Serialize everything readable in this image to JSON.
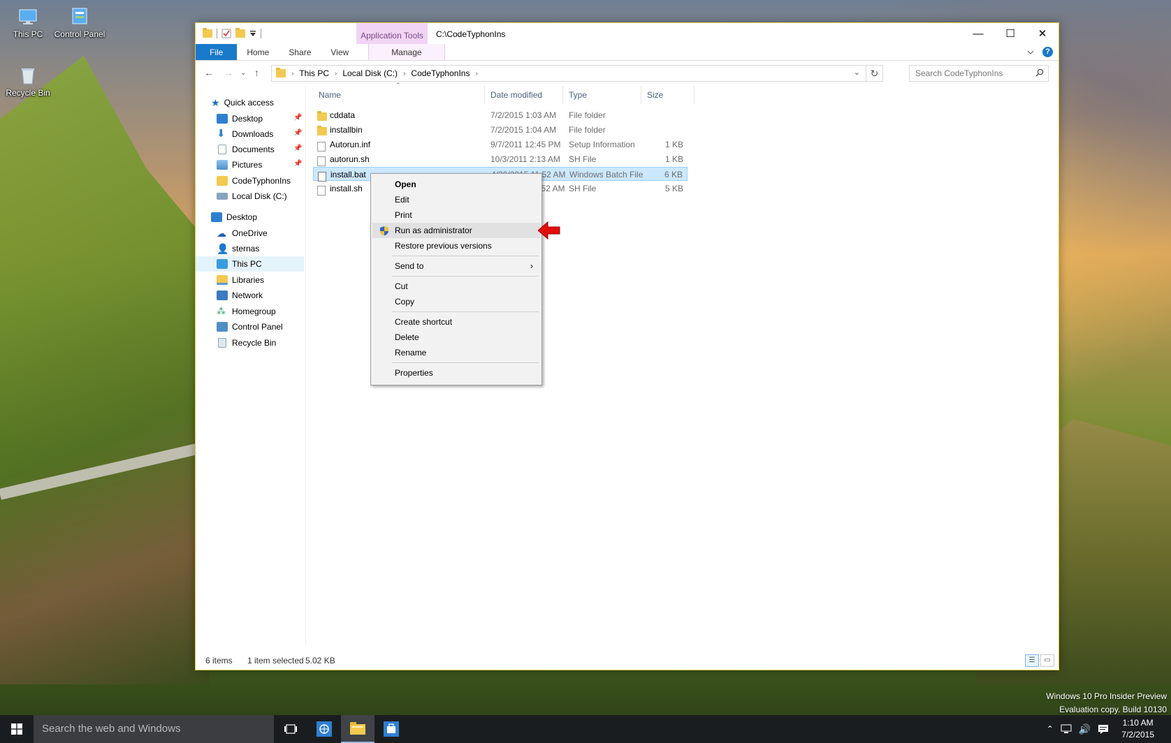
{
  "desktop": {
    "icons": [
      {
        "label": "This PC"
      },
      {
        "label": "Control Panel"
      },
      {
        "label": "Recycle Bin"
      }
    ],
    "watermark": {
      "line1": "Windows 10 Pro Insider Preview",
      "line2": "Evaluation copy. Build 10130"
    }
  },
  "window": {
    "title": "C:\\CodeTyphonIns",
    "app_tools_label": "Application Tools",
    "tabs": {
      "file": "File",
      "home": "Home",
      "share": "Share",
      "view": "View",
      "manage": "Manage"
    },
    "controls": {
      "minimize": "—",
      "maximize": "☐",
      "close": "✕"
    },
    "help": "?",
    "address": {
      "crumbs": [
        "This PC",
        "Local Disk (C:)",
        "CodeTyphonIns"
      ]
    },
    "search": {
      "placeholder": "Search CodeTyphonIns"
    }
  },
  "nav": {
    "quick_access": "Quick access",
    "qa_items": [
      {
        "label": "Desktop",
        "color": "#2f7fd1"
      },
      {
        "label": "Downloads",
        "color": "#2f7fd1"
      },
      {
        "label": "Documents",
        "color": "#8fa3b8"
      },
      {
        "label": "Pictures",
        "color": "#4f8fc6"
      },
      {
        "label": "CodeTyphonIns",
        "color": "#f3c94f"
      },
      {
        "label": "Local Disk (C:)",
        "color": "#8aa3bd"
      }
    ],
    "tree": [
      {
        "label": "Desktop",
        "color": "#2f7fd1"
      },
      {
        "label": "OneDrive",
        "color": "#1f5fb5"
      },
      {
        "label": "sternas",
        "color": "#6a8a5a"
      },
      {
        "label": "This PC",
        "color": "#3c9be0"
      },
      {
        "label": "Libraries",
        "color": "#f3c94f"
      },
      {
        "label": "Network",
        "color": "#3c7bc0"
      },
      {
        "label": "Homegroup",
        "color": "#2b9f6a"
      },
      {
        "label": "Control Panel",
        "color": "#4f8fc6"
      },
      {
        "label": "Recycle Bin",
        "color": "#8aa3bd"
      }
    ]
  },
  "columns": {
    "name": "Name",
    "date": "Date modified",
    "type": "Type",
    "size": "Size"
  },
  "files": [
    {
      "name": "cddata",
      "date": "7/2/2015 1:03 AM",
      "type": "File folder",
      "size": "",
      "kind": "folder"
    },
    {
      "name": "installbin",
      "date": "7/2/2015 1:04 AM",
      "type": "File folder",
      "size": "",
      "kind": "folder"
    },
    {
      "name": "Autorun.inf",
      "date": "9/7/2011 12:45 PM",
      "type": "Setup Information",
      "size": "1 KB",
      "kind": "file"
    },
    {
      "name": "autorun.sh",
      "date": "10/3/2011 2:13 AM",
      "type": "SH File",
      "size": "1 KB",
      "kind": "file"
    },
    {
      "name": "install.bat",
      "date": "4/20/2015 11:52 AM",
      "type": "Windows Batch File",
      "size": "6 KB",
      "kind": "file",
      "selected": true
    },
    {
      "name": "install.sh",
      "date": "4/20/2015 11:52 AM",
      "type": "SH File",
      "size": "5 KB",
      "kind": "file"
    }
  ],
  "status": {
    "count": "6 items",
    "selected": "1 item selected",
    "size": "5.02 KB"
  },
  "context_menu": {
    "open": "Open",
    "edit": "Edit",
    "print": "Print",
    "run_as_admin": "Run as administrator",
    "restore": "Restore previous versions",
    "send_to": "Send to",
    "cut": "Cut",
    "copy": "Copy",
    "create_shortcut": "Create shortcut",
    "delete": "Delete",
    "rename": "Rename",
    "properties": "Properties"
  },
  "taskbar": {
    "search_placeholder": "Search the web and Windows",
    "time": "1:10 AM",
    "date": "7/2/2015"
  }
}
